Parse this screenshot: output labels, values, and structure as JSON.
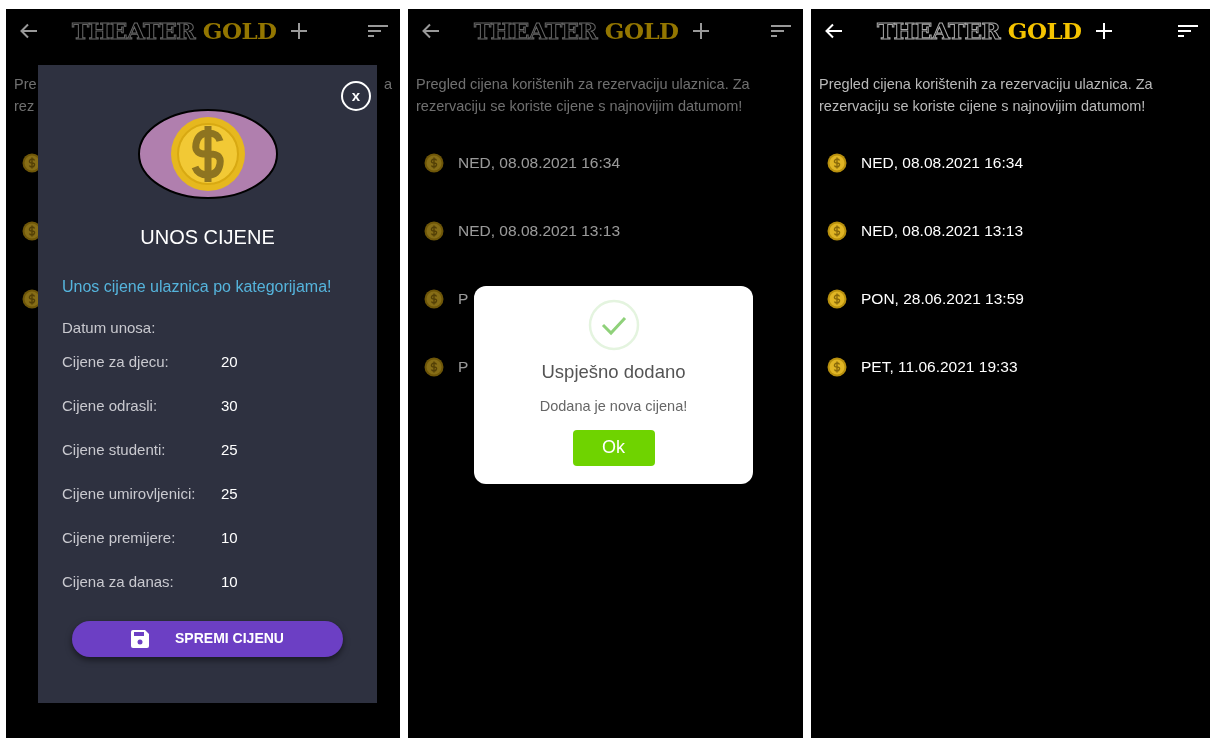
{
  "screens": [
    {
      "dimmed": true,
      "header": {
        "title": "THEATER **GOLD**"
      },
      "intro_lines": [
        [
          "Pre",
          "a"
        ],
        [
          "rez"
        ]
      ],
      "prices": [
        {
          "kind": "coin"
        },
        {
          "kind": "coin"
        },
        {
          "kind": "coin"
        }
      ],
      "overlay": {
        "kind": "form",
        "close": "x",
        "title": "UNOS CIJENE",
        "subtitle": "Unos cijene ulaznica po kategorijama!",
        "date_label": "Datum unosa:",
        "fields": [
          {
            "label": "Cijene za djecu:",
            "value": "20"
          },
          {
            "label": "Cijene odrasli:",
            "value": "30"
          },
          {
            "label": "Cijene studenti:",
            "value": "25"
          },
          {
            "label": "Cijene umirovljenici:",
            "value": "25"
          },
          {
            "label": "Cijene premijere:",
            "value": "10"
          },
          {
            "label": "Cijena za danas:",
            "value": "10"
          }
        ],
        "button": "SPREMI CIJENU"
      }
    },
    {
      "dimmed": true,
      "header": {
        "title": "THEATER **GOLD**"
      },
      "intro_lines": [
        [
          "Pregled cijena korištenih za rezervaciju ulaznica. Za"
        ],
        [
          "rezervaciju se koriste cijene s najnovijim datumom!"
        ]
      ],
      "prices": [
        {
          "kind": "dated",
          "date": "NED, 08.08.2021 16:34"
        },
        {
          "kind": "dated",
          "date": "NED, 08.08.2021 13:13"
        },
        {
          "kind": "dated",
          "date": "P"
        },
        {
          "kind": "dated",
          "date": "P"
        }
      ],
      "overlay": {
        "kind": "alert",
        "title": "Uspješno dodano",
        "message": "Dodana je nova cijena!",
        "button": "Ok"
      }
    },
    {
      "dimmed": false,
      "header": {
        "title": "THEATER **GOLD**"
      },
      "intro_lines": [
        [
          "Pregled cijena korištenih za rezervaciju ulaznica. Za"
        ],
        [
          "rezervaciju se koriste cijene s najnovijim datumom!"
        ]
      ],
      "prices": [
        {
          "kind": "dated",
          "date": "NED, 08.08.2021 16:34"
        },
        {
          "kind": "dated",
          "date": "NED, 08.08.2021 13:13"
        },
        {
          "kind": "dated",
          "date": "PON, 28.06.2021 13:59"
        },
        {
          "kind": "dated",
          "date": "PET, 11.06.2021 19:33"
        }
      ]
    }
  ]
}
